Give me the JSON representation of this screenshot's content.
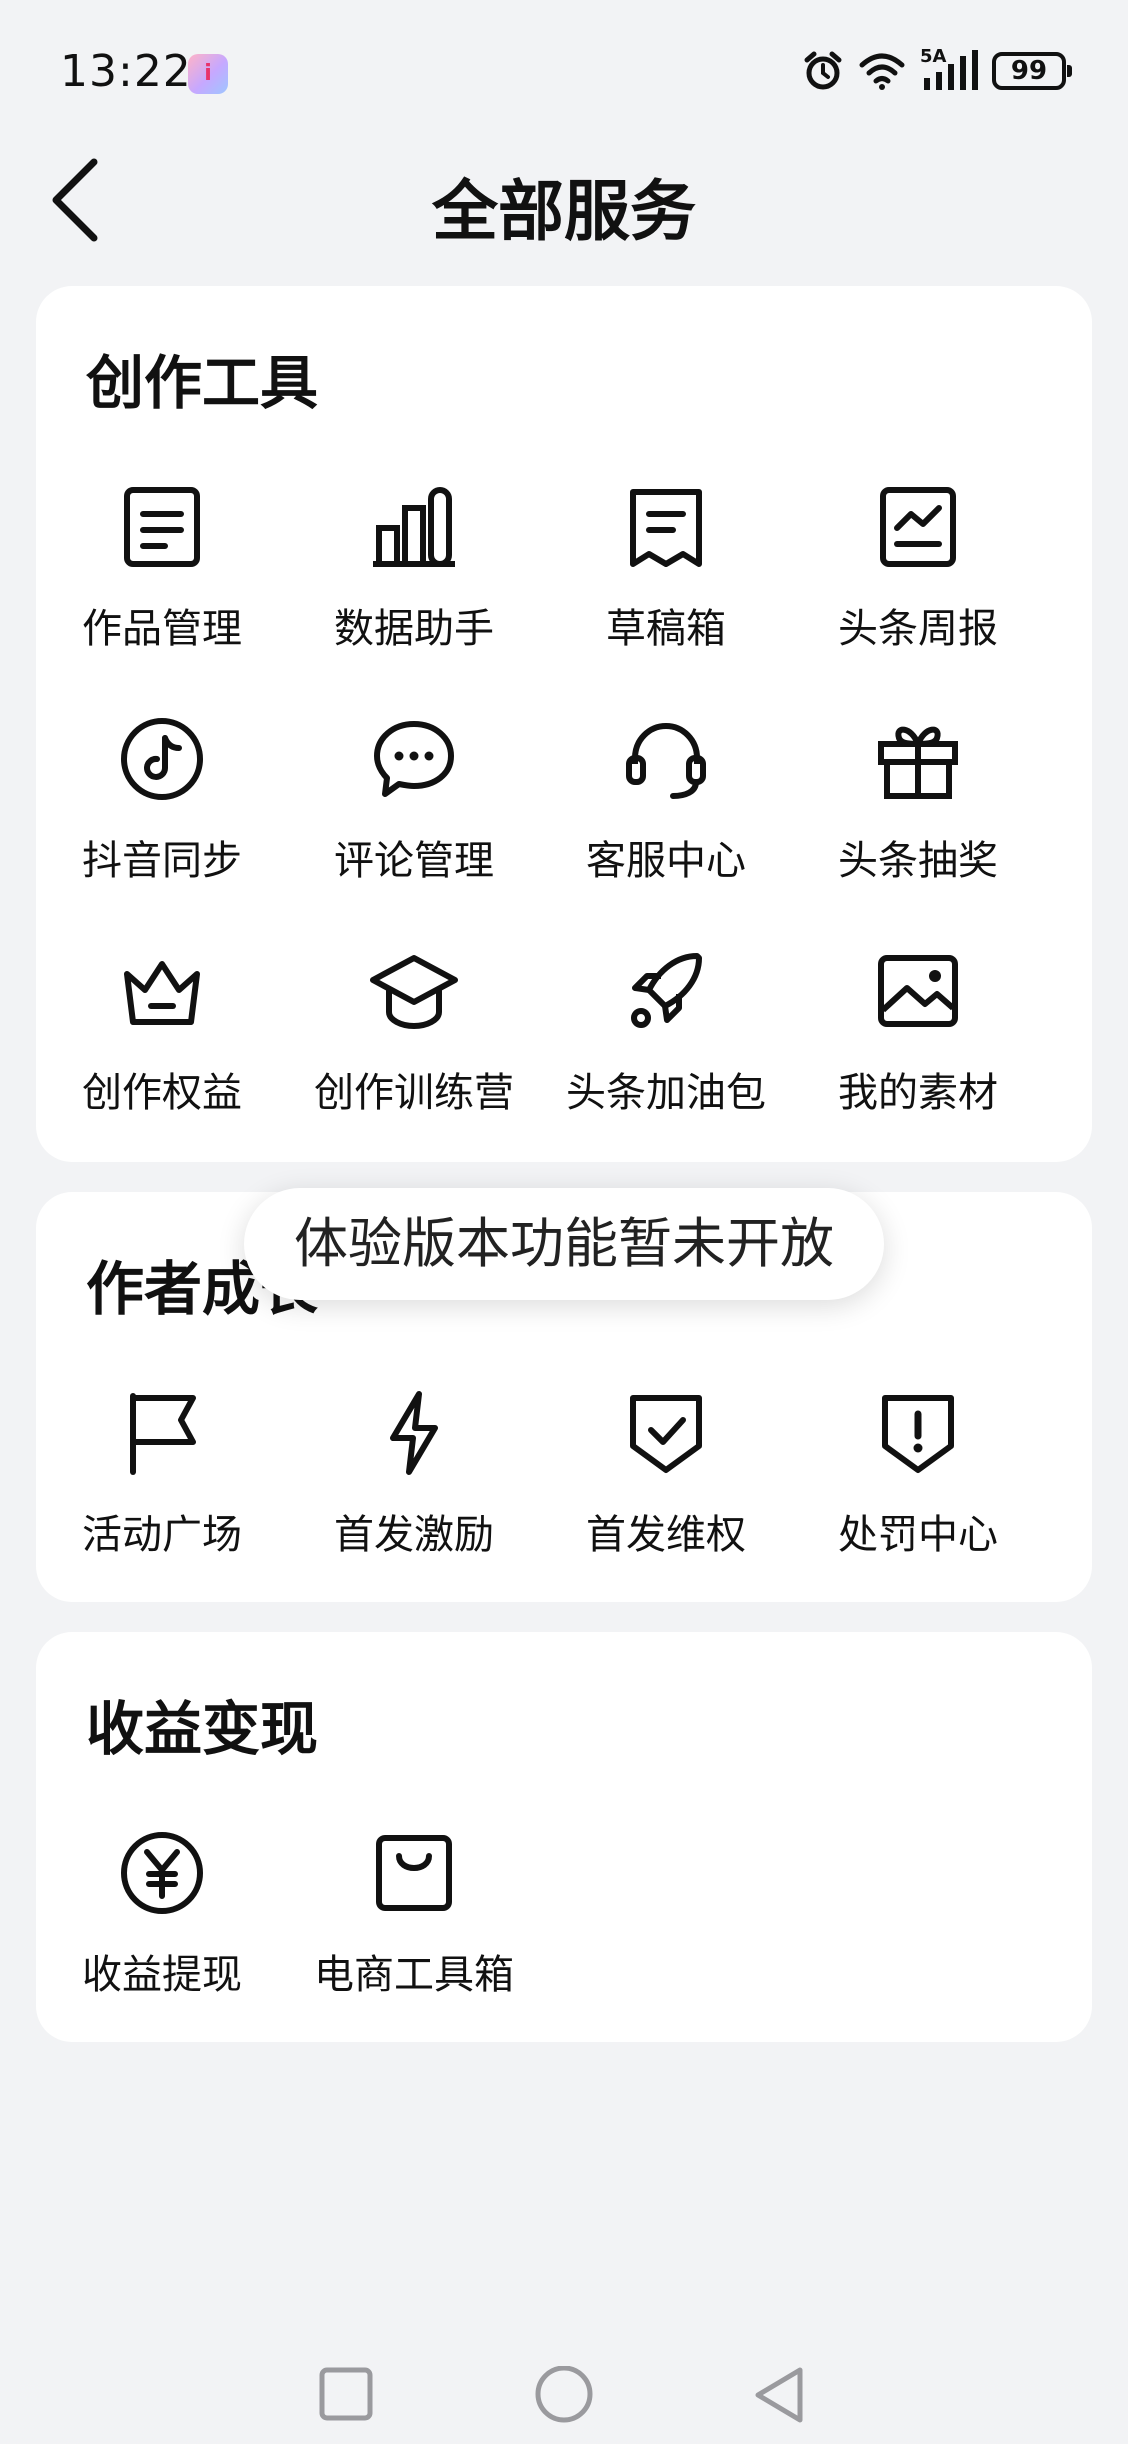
{
  "status_bar": {
    "time": "13:22",
    "app_badge": "i",
    "network_label": "5A",
    "battery": "99",
    "icons": [
      "alarm-icon",
      "wifi-icon",
      "signal-icon",
      "battery-icon"
    ]
  },
  "header": {
    "title": "全部服务",
    "back_icon": "back-arrow-icon"
  },
  "sections": [
    {
      "title": "创作工具",
      "items": [
        {
          "label": "作品管理",
          "icon": "document-icon"
        },
        {
          "label": "数据助手",
          "icon": "bar-chart-icon"
        },
        {
          "label": "草稿箱",
          "icon": "draft-icon"
        },
        {
          "label": "头条周报",
          "icon": "trend-report-icon"
        },
        {
          "label": "抖音同步",
          "icon": "douyin-icon"
        },
        {
          "label": "评论管理",
          "icon": "comment-icon"
        },
        {
          "label": "客服中心",
          "icon": "headset-icon"
        },
        {
          "label": "头条抽奖",
          "icon": "gift-icon"
        },
        {
          "label": "创作权益",
          "icon": "crown-icon"
        },
        {
          "label": "创作训练营",
          "icon": "graduation-cap-icon"
        },
        {
          "label": "头条加油包",
          "icon": "rocket-icon"
        },
        {
          "label": "我的素材",
          "icon": "image-icon"
        }
      ]
    },
    {
      "title": "作者成长",
      "items": [
        {
          "label": "活动广场",
          "icon": "flag-icon"
        },
        {
          "label": "首发激励",
          "icon": "lightning-icon"
        },
        {
          "label": "首发维权",
          "icon": "shield-check-icon"
        },
        {
          "label": "处罚中心",
          "icon": "shield-alert-icon"
        }
      ]
    },
    {
      "title": "收益变现",
      "items": [
        {
          "label": "收益提现",
          "icon": "yen-coin-icon"
        },
        {
          "label": "电商工具箱",
          "icon": "shopping-bag-icon"
        }
      ]
    }
  ],
  "toast": {
    "message": "体验版本功能暂未开放"
  },
  "nav_bar": {
    "buttons": [
      "recents-square-icon",
      "home-circle-icon",
      "back-triangle-icon"
    ]
  },
  "colors": {
    "background": "#f2f3f5",
    "card": "#ffffff",
    "text": "#111111"
  }
}
